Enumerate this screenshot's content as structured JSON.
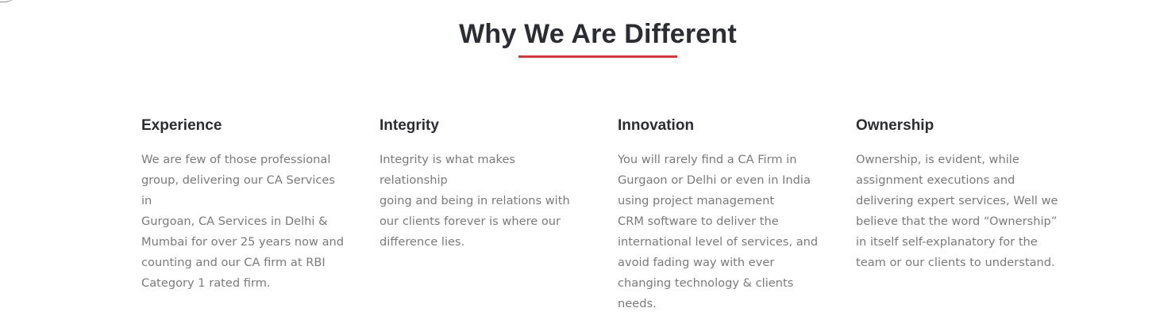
{
  "section": {
    "title": "Why We Are Different",
    "accent_color": "#d0393b"
  },
  "features": [
    {
      "heading": "Experience",
      "text": "We are few of those professional\ngroup, delivering our CA Services in\nGurgoan, CA Services in Delhi &\nMumbai for over 25 years now and\ncounting and our CA firm at RBI\nCategory 1 rated firm."
    },
    {
      "heading": "Integrity",
      "text": "Integrity is what makes relationship\ngoing and being in relations with\nour clients forever is where our\ndifference lies."
    },
    {
      "heading": "Innovation",
      "text": "You will rarely find a CA Firm in\nGurgaon or Delhi or even in India\nusing project management\nCRM software to deliver the\ninternational  level of services, and\navoid fading way with ever\nchanging technology & clients\nneeds."
    },
    {
      "heading": "Ownership",
      "text": "Ownership, is evident, while\nassignment executions and\ndelivering expert services, Well we\nbelieve that the word “Ownership”\nin itself self-explanatory for the\nteam or our clients to understand."
    }
  ]
}
